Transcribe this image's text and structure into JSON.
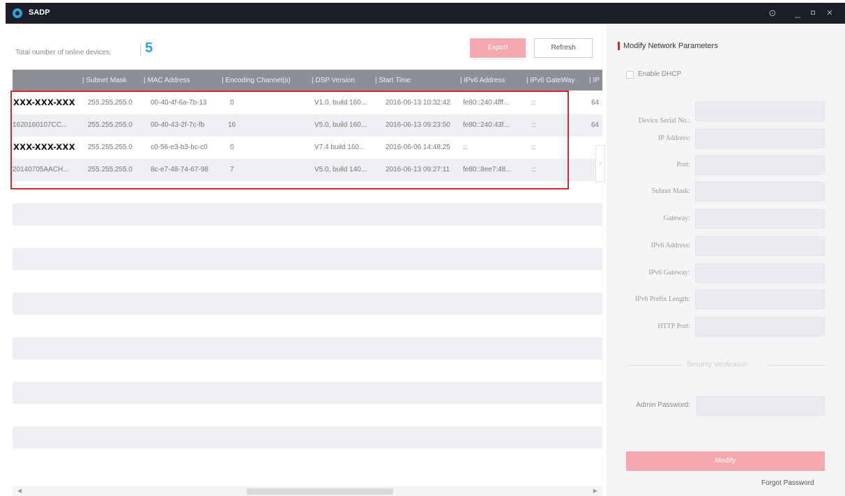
{
  "titlebar": {
    "app_title": "SADP",
    "icons": [
      "sadp-logo-icon",
      "help-icon",
      "minimize-icon",
      "restore-icon",
      "close-icon"
    ],
    "help_glyph": "⊙",
    "minimize_glyph": "_",
    "restore_glyph": "◘",
    "close_glyph": "×"
  },
  "toolbar": {
    "total_label": "Total number of online devices:",
    "total_count": "5",
    "export_label": "Export",
    "refresh_label": "Refresh"
  },
  "table": {
    "columns": [
      "| Subnet Mask",
      "| MAC Address",
      "| Encoding Channel(s)",
      "| DSP Version",
      "| Start Time",
      "| IPv6 Address",
      "| IPv6 GateWay",
      "| IP"
    ],
    "rows": [
      {
        "device": "XXX-XXX-XXX",
        "subnet": "255.255.255.0",
        "mac": "00-40-4f-6a-7b-13",
        "channels": "0",
        "dsp": "V1.0, build 160...",
        "start": "2016-06-13 10:32:42",
        "ipv6": "fe80::240:4fff...",
        "gateway": "::",
        "extra": "64"
      },
      {
        "device": "1620160107CC...",
        "subnet": "255.255.255.0",
        "mac": "00-40-43-2f-7c-fb",
        "channels": "16",
        "dsp": "V5.0, build 160...",
        "start": "2016-06-13 09:23:50",
        "ipv6": "fe80::240:43f...",
        "gateway": "::",
        "extra": "64"
      },
      {
        "device": "XXX-XXX-XXX",
        "subnet": "255.255.255.0",
        "mac": "c0-56-e3-b3-bc-c0",
        "channels": "0",
        "dsp": "V7.4 build 160...",
        "start": "2016-06-06 14:48:25",
        "ipv6": "::",
        "gateway": "::",
        "extra": ""
      },
      {
        "device": "20140705AACH...",
        "subnet": "255.255.255.0",
        "mac": "8c-e7-48-74-67-98",
        "channels": "7",
        "dsp": "V5.0, build 140...",
        "start": "2016-06-13 09:27:11",
        "ipv6": "fe80::8ee7:48...",
        "gateway": "::",
        "extra": ""
      }
    ],
    "collapse_glyph": "›"
  },
  "scrollbar": {
    "left_arrow": "◀",
    "right_arrow": "▶"
  },
  "panel": {
    "title": "Modify Network Parameters",
    "enable_dhcp": "Enable DHCP",
    "fields": [
      {
        "label": "Device Serial No.:"
      },
      {
        "label": "IP Address:"
      },
      {
        "label": "Port:"
      },
      {
        "label": "Subnet Mask:"
      },
      {
        "label": "Gateway:"
      },
      {
        "label": "IPv6 Address:"
      },
      {
        "label": "IPv6 Gateway:"
      },
      {
        "label": "IPv6 Prefix Length:"
      },
      {
        "label": "HTTP Port:"
      }
    ],
    "security_title": "Security Verification",
    "admin_password_label": "Admin Password:",
    "modify_label": "Modify",
    "forgot_password": "Forgot Password"
  },
  "colors": {
    "titlebar": "#1b1e26",
    "accent_blue": "#2aa2df",
    "accent_red": "#d9262a",
    "disabled_button": "#f3a9ad",
    "header_gray": "#8c8f95"
  }
}
